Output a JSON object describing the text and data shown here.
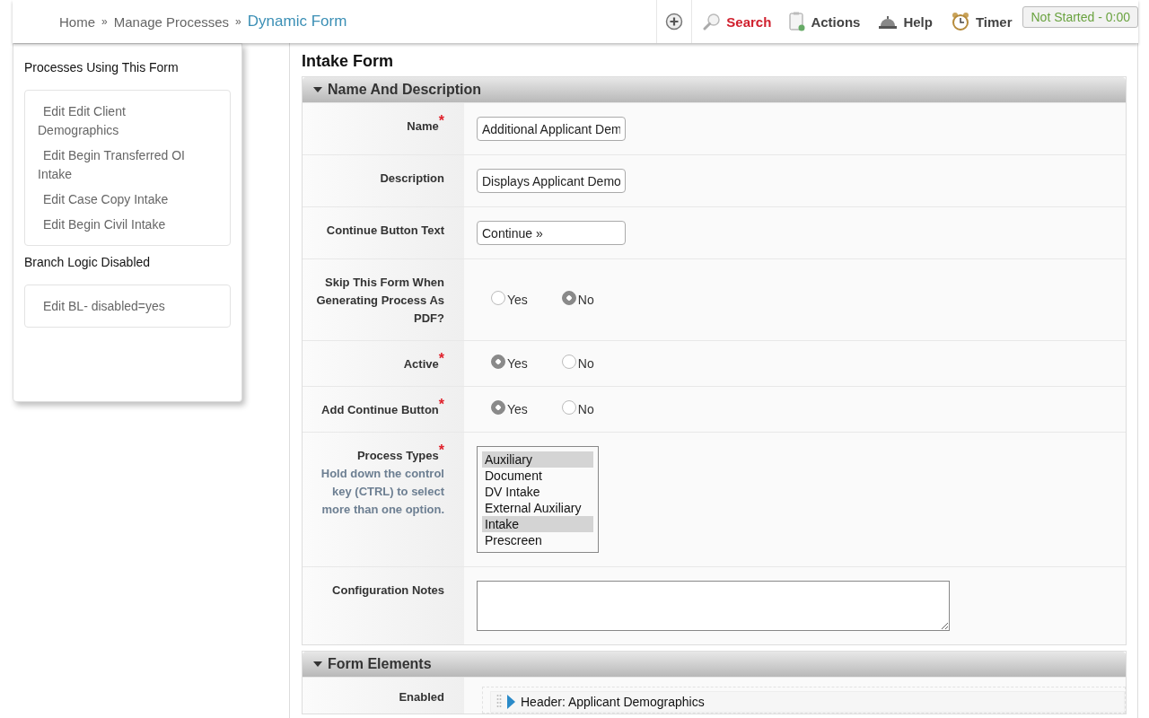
{
  "breadcrumbs": [
    {
      "label": "Home",
      "current": false
    },
    {
      "label": "Manage Processes",
      "current": false
    },
    {
      "label": "Dynamic Form",
      "current": true
    }
  ],
  "breadcrumb_separator": "»",
  "toolbar": [
    {
      "kind": "add"
    },
    {
      "kind": "search",
      "label": "Search"
    },
    {
      "kind": "actions",
      "label": "Actions"
    },
    {
      "kind": "help",
      "label": "Help"
    },
    {
      "kind": "timer",
      "label": "Timer"
    }
  ],
  "timer_status": "Not Started - 0:00",
  "sidebar": [
    {
      "title": "Processes Using This Form",
      "items": [
        "Edit Edit Client Demographics",
        "Edit Begin Transferred OI Intake",
        "Edit Case Copy Intake",
        "Edit Begin Civil Intake"
      ]
    },
    {
      "title": "Branch Logic Disabled",
      "items": [
        "Edit BL- disabled=yes"
      ]
    }
  ],
  "page_title": "Intake Form",
  "sections": [
    {
      "title": "Name And Description",
      "rows": [
        {
          "kind": "text",
          "label": "Name",
          "required_mark": "*",
          "value": "Additional Applicant Dem"
        },
        {
          "kind": "text",
          "label": "Description",
          "value": "Displays Applicant Demo"
        },
        {
          "kind": "text",
          "label": "Continue Button Text",
          "value": "Continue »"
        },
        {
          "kind": "radio",
          "label": "Skip This Form When Generating Process As PDF?",
          "options": [
            {
              "label": "Yes",
              "selected": false
            },
            {
              "label": "No",
              "selected": true
            }
          ]
        },
        {
          "kind": "radio",
          "label": "Active",
          "required_mark": "*",
          "options": [
            {
              "label": "Yes",
              "selected": true
            },
            {
              "label": "No",
              "selected": false
            }
          ]
        },
        {
          "kind": "radio",
          "label": "Add Continue Button",
          "required_mark": "*",
          "options": [
            {
              "label": "Yes",
              "selected": true
            },
            {
              "label": "No",
              "selected": false
            }
          ]
        },
        {
          "kind": "multiselect",
          "label": "Process Types",
          "required_mark": "*",
          "hint": "Hold down the control key (CTRL) to select more than one option.",
          "options": [
            {
              "label": "Auxiliary",
              "selected": true
            },
            {
              "label": "Document",
              "selected": false
            },
            {
              "label": "DV Intake",
              "selected": false
            },
            {
              "label": "External Auxiliary",
              "selected": false
            },
            {
              "label": "Intake",
              "selected": true
            },
            {
              "label": "Prescreen",
              "selected": false
            }
          ]
        },
        {
          "kind": "textarea",
          "label": "Configuration Notes",
          "value": ""
        }
      ]
    },
    {
      "title": "Form Elements",
      "rows": [
        {
          "kind": "elements",
          "label": "Enabled",
          "items": [
            "Header: Applicant Demographics"
          ]
        }
      ]
    }
  ]
}
